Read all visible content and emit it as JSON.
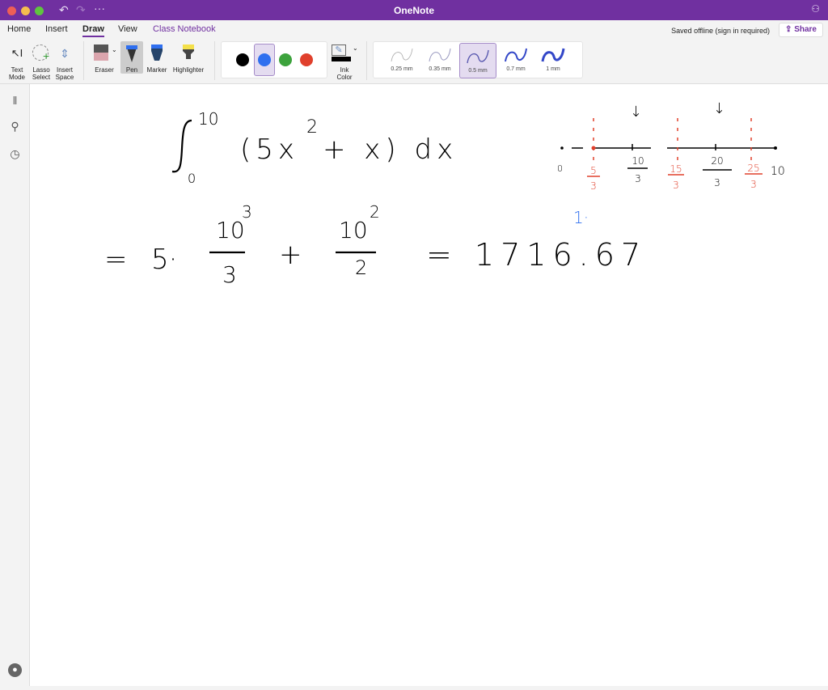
{
  "window": {
    "title": "OneNote",
    "traffic_lights": {
      "close": "#ee5f57",
      "minimize": "#f5bd4f",
      "zoom": "#5fc43f"
    },
    "accent": "#7030a0"
  },
  "tabs": [
    {
      "label": "Home"
    },
    {
      "label": "Insert"
    },
    {
      "label": "Draw",
      "active": true
    },
    {
      "label": "View"
    },
    {
      "label": "Class Notebook"
    }
  ],
  "status": "Saved offline (sign in required)",
  "share_label": "Share",
  "ribbon": {
    "text_mode": [
      "Text",
      "Mode"
    ],
    "lasso": [
      "Lasso",
      "Select"
    ],
    "insert_space": [
      "Insert",
      "Space"
    ],
    "eraser": "Eraser",
    "pen": "Pen",
    "marker": "Marker",
    "highlighter": "Highlighter",
    "ink_colors": [
      {
        "name": "black",
        "hex": "#000000"
      },
      {
        "name": "blue",
        "hex": "#2f6fef",
        "selected": true
      },
      {
        "name": "green",
        "hex": "#3da33d"
      },
      {
        "name": "red",
        "hex": "#e0402c"
      }
    ],
    "ink_color": [
      "Ink",
      "Color"
    ],
    "thicknesses": [
      {
        "label": "0.25 mm"
      },
      {
        "label": "0.35 mm"
      },
      {
        "label": "0.5 mm",
        "selected": true
      },
      {
        "label": "0.7 mm"
      },
      {
        "label": "1 mm"
      }
    ]
  },
  "ink": {
    "integral": {
      "upper": "10",
      "lower": "0",
      "integrand": "(5x",
      "exp": "2",
      "rest": "+ x) dx"
    },
    "line2": {
      "eq": "=",
      "five": "5·",
      "n1": "10",
      "e1": "3",
      "d1": "3",
      "plus": "+",
      "n2": "10",
      "e2": "2",
      "d2": "2",
      "result": "= 1716.67"
    },
    "numberline": {
      "zero": "0",
      "ten": "10",
      "black_labels": [
        {
          "n": "10",
          "d": "3"
        },
        {
          "n": "20",
          "d": "3"
        }
      ],
      "red_labels": [
        {
          "n": "5",
          "d": "3"
        },
        {
          "n": "15",
          "d": "3"
        },
        {
          "n": "25",
          "d": "3"
        }
      ]
    },
    "blue_note": "1·"
  }
}
